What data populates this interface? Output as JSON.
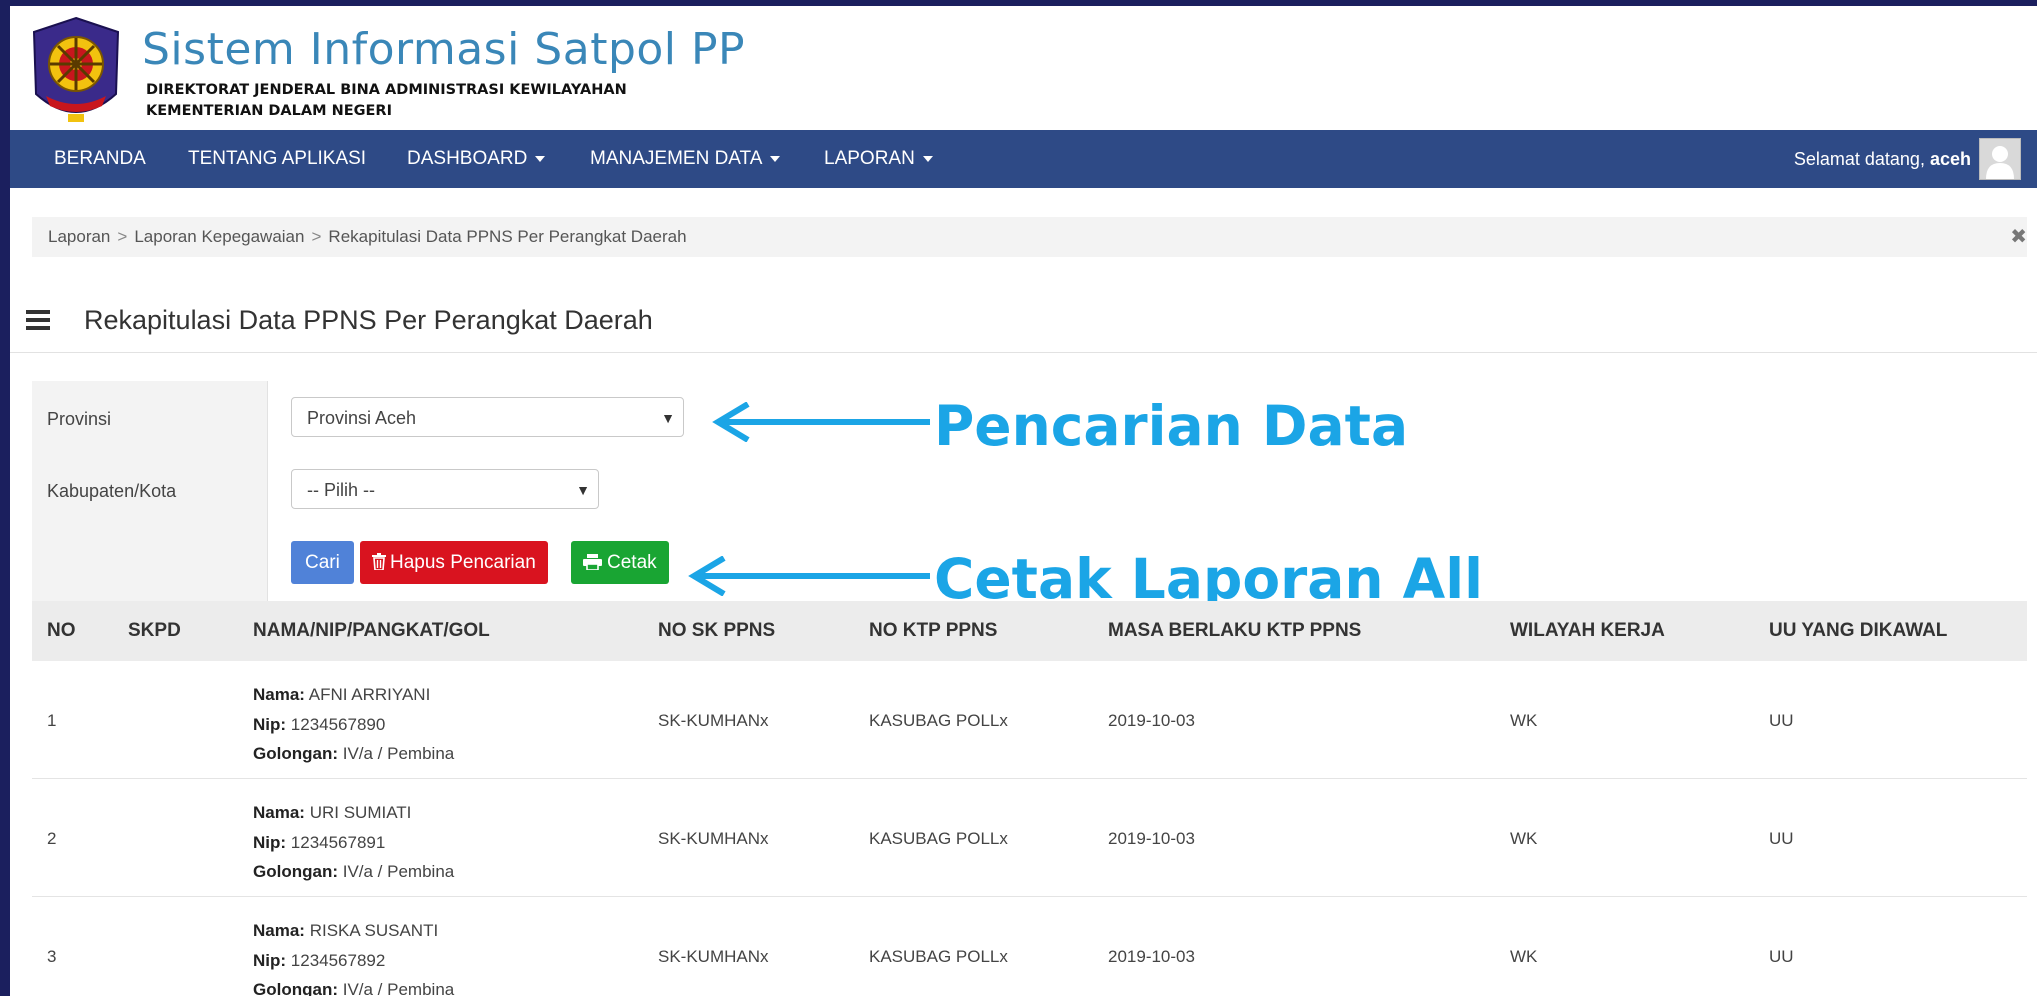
{
  "header": {
    "title": "Sistem Informasi Satpol PP",
    "subtitle_line1": "DIREKTORAT JENDERAL BINA ADMINISTRASI KEWILAYAHAN",
    "subtitle_line2": "KEMENTERIAN DALAM NEGERI"
  },
  "nav": {
    "items": [
      {
        "label": "BERANDA"
      },
      {
        "label": "TENTANG APLIKASI"
      },
      {
        "label": "DASHBOARD"
      },
      {
        "label": "MANAJEMEN DATA"
      },
      {
        "label": "LAPORAN"
      }
    ],
    "welcome_prefix": "Selamat datang,",
    "username": "aceh"
  },
  "breadcrumb": {
    "items": [
      "Laporan",
      "Laporan Kepegawaian",
      "Rekapitulasi Data PPNS Per Perangkat Daerah"
    ],
    "close_icon": "✖"
  },
  "page": {
    "title": "Rekapitulasi Data PPNS Per Perangkat Daerah"
  },
  "search": {
    "provinsi_label": "Provinsi",
    "provinsi_value": "Provinsi Aceh",
    "kabkota_label": "Kabupaten/Kota",
    "kabkota_value": "-- Pilih --",
    "btn_cari": "Cari",
    "btn_hapus": "Hapus Pencarian",
    "btn_cetak": "Cetak"
  },
  "annotations": {
    "search_note": "Pencarian Data",
    "print_note": "Cetak Laporan All",
    "color": "#1ba5e6"
  },
  "table": {
    "headers": [
      "NO",
      "SKPD",
      "NAMA/NIP/PANGKAT/GOL",
      "NO SK PPNS",
      "NO KTP PPNS",
      "MASA BERLAKU KTP PPNS",
      "WILAYAH KERJA",
      "UU YANG DIKAWAL"
    ],
    "labels": {
      "nama": "Nama:",
      "nip": "Nip:",
      "golongan": "Golongan:"
    },
    "rows": [
      {
        "no": "1",
        "skpd": "",
        "nama": "AFNI ARRIYANI",
        "nip": "1234567890",
        "golongan": "IV/a / Pembina",
        "no_sk": "SK-KUMHANx",
        "no_ktp": "KASUBAG POLLx",
        "masa_berlaku": "2019-10-03",
        "wilayah": "WK",
        "uu": "UU"
      },
      {
        "no": "2",
        "skpd": "",
        "nama": "URI SUMIATI",
        "nip": "1234567891",
        "golongan": "IV/a / Pembina",
        "no_sk": "SK-KUMHANx",
        "no_ktp": "KASUBAG POLLx",
        "masa_berlaku": "2019-10-03",
        "wilayah": "WK",
        "uu": "UU"
      },
      {
        "no": "3",
        "skpd": "",
        "nama": "RISKA SUSANTI",
        "nip": "1234567892",
        "golongan": "IV/a / Pembina",
        "no_sk": "SK-KUMHANx",
        "no_ktp": "KASUBAG POLLx",
        "masa_berlaku": "2019-10-03",
        "wilayah": "WK",
        "uu": "UU"
      }
    ]
  }
}
